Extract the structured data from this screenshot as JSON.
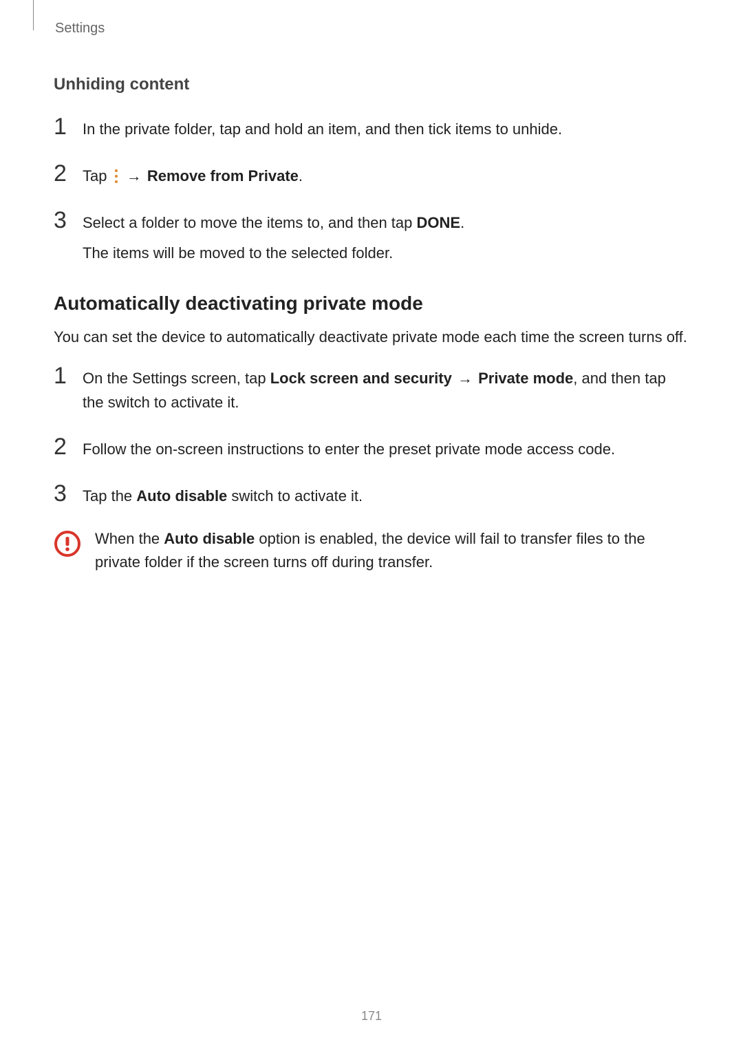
{
  "breadcrumb": "Settings",
  "section1": {
    "title": "Unhiding content",
    "steps": {
      "s1": "In the private folder, tap and hold an item, and then tick items to unhide.",
      "s2_pre": "Tap ",
      "s2_post": " → ",
      "s2_bold": "Remove from Private",
      "s2_end": ".",
      "s3a_pre": "Select a folder to move the items to, and then tap ",
      "s3a_bold": "DONE",
      "s3a_end": ".",
      "s3b": "The items will be moved to the selected folder."
    }
  },
  "section2": {
    "title": "Automatically deactivating private mode",
    "intro": "You can set the device to automatically deactivate private mode each time the screen turns off.",
    "steps": {
      "s1_pre": "On the Settings screen, tap ",
      "s1_bold1": "Lock screen and security",
      "s1_arrow": " → ",
      "s1_bold2": "Private mode",
      "s1_post": ", and then tap the switch to activate it.",
      "s2": "Follow the on-screen instructions to enter the preset private mode access code.",
      "s3_pre": "Tap the ",
      "s3_bold": "Auto disable",
      "s3_post": " switch to activate it."
    },
    "callout_pre": "When the ",
    "callout_bold": "Auto disable",
    "callout_post": " option is enabled, the device will fail to transfer files to the private folder if the screen turns off during transfer."
  },
  "pageNumber": "171",
  "nums": {
    "n1": "1",
    "n2": "2",
    "n3": "3"
  }
}
